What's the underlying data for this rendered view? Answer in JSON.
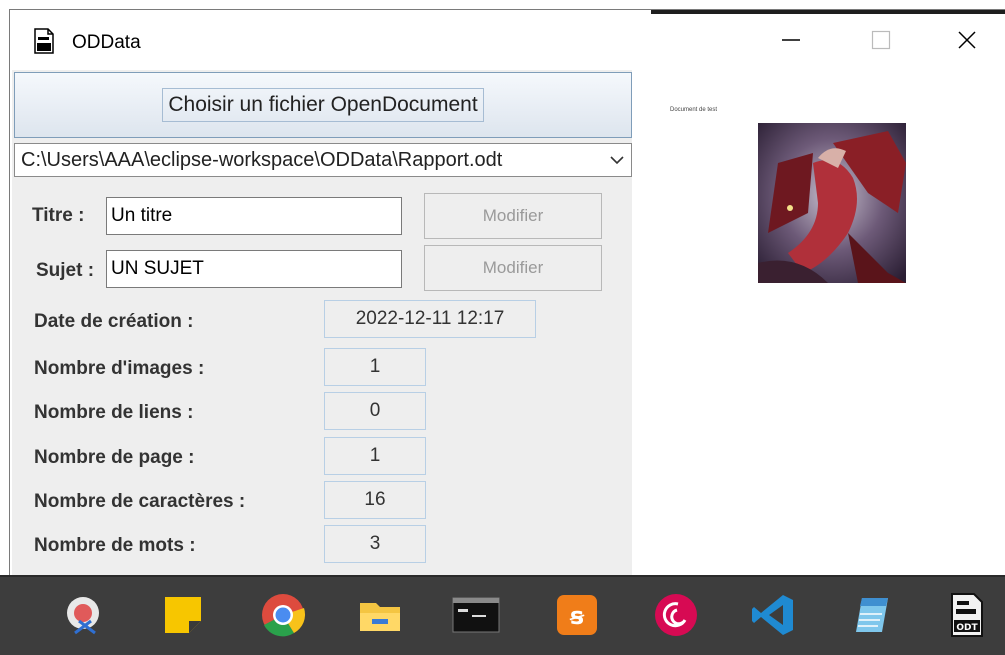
{
  "window": {
    "title": "ODData"
  },
  "controls": {
    "choose_label": "Choisir un fichier OpenDocument",
    "path_value": "C:\\Users\\AAA\\eclipse-workspace\\ODData\\Rapport.odt"
  },
  "form": {
    "titre_label": "Titre :",
    "titre_value": "Un titre",
    "sujet_label": "Sujet :",
    "sujet_value": "UN SUJET",
    "modify_label": "Modifier"
  },
  "info": [
    {
      "label": "Date de création :",
      "value": "2022-12-11 12:17"
    },
    {
      "label": "Nombre d'images :",
      "value": "1"
    },
    {
      "label": "Nombre de liens :",
      "value": "0"
    },
    {
      "label": "Nombre de page :",
      "value": "1"
    },
    {
      "label": "Nombre de caractères :",
      "value": "16"
    },
    {
      "label": "Nombre de mots :",
      "value": "3"
    }
  ],
  "preview": {
    "caption": "Document de test",
    "image": "dragon-image"
  },
  "taskbar": {
    "icons": [
      "snipping-tool-icon",
      "sticky-notes-icon",
      "chrome-icon",
      "file-explorer-icon",
      "terminal-icon",
      "xampp-icon",
      "debian-icon",
      "vscode-icon",
      "notepad-icon",
      "odt-file-icon"
    ]
  }
}
